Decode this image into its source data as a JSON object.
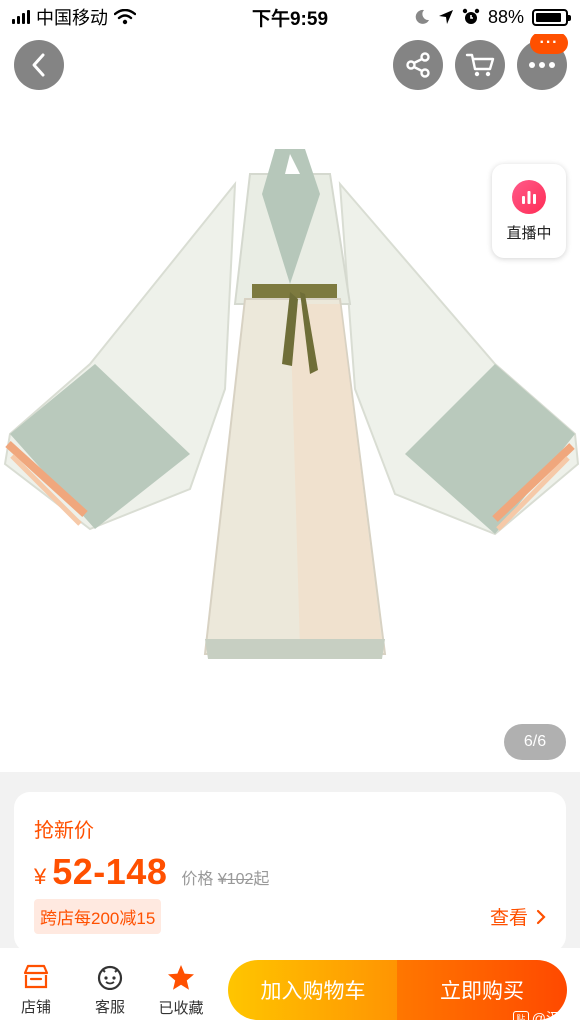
{
  "status_bar": {
    "carrier": "中国移动",
    "time": "下午9:59",
    "battery": "88%",
    "battery_level": 0.88
  },
  "gallery": {
    "live_label": "直播中",
    "counter": "6/6",
    "cart_badge": "···"
  },
  "product": {
    "promo_title": "抢新价",
    "currency": "¥",
    "price": "52-148",
    "orig_label": "价格",
    "orig_price": "¥102",
    "orig_suffix": "起",
    "coupon": "跨店每200减15",
    "view_more": "查看"
  },
  "bottom_bar": {
    "store": "店铺",
    "service": "客服",
    "favorite": "已收藏",
    "add_to_cart": "加入购物车",
    "buy_now": "立即购买",
    "watermark": "@汉服"
  },
  "colors": {
    "accent": "#ff5000",
    "cart_button": "#ffb000",
    "buy_button": "#ff5a00"
  }
}
